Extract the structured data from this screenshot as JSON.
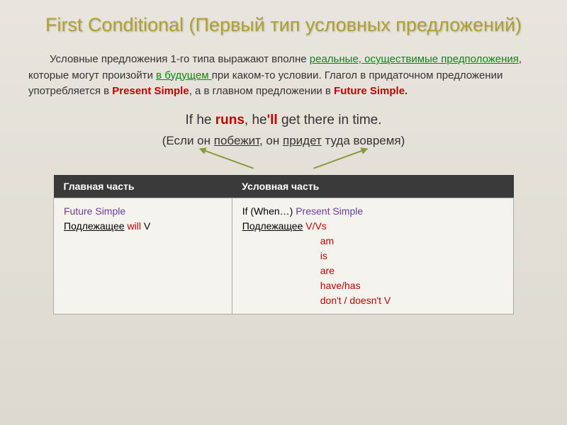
{
  "title": "First Conditional (Первый тип условных предложений)",
  "paragraph": {
    "p1": "Условные предложения 1-го типа выражают вполне ",
    "green1": "реальные, осуществимые предположения",
    "p2": ", которые могут произойти ",
    "green2": "в будущем ",
    "p3": "при каком-то условии. Глагол в придаточном предложении употребляется в ",
    "red1": "Present Simple",
    "p4": ", а в главном предложении в ",
    "red2": "Future Simple.",
    "p5": ""
  },
  "example_en": {
    "t1": "If he ",
    "verb1": "runs",
    "t2": ", he",
    "verb2": "'ll",
    "t3": " get there in time."
  },
  "example_ru": {
    "open": "(",
    "t1": "Если он ",
    "u1": "побежит",
    "t2": ", он ",
    "u2": "придет",
    "t3": " туда вовремя)",
    "close": ""
  },
  "table": {
    "header1": "Главная часть",
    "header2": "Условная часть",
    "cell1": {
      "line1a": "Future Simple",
      "line2a": "Подлежащее",
      "line2b": " will",
      "line2c": "  V"
    },
    "cell2": {
      "line1a": "If (When…) ",
      "line1b": "Present Simple",
      "line2a": "Подлежащее",
      "line2b": "  V/Vs",
      "line3": "am",
      "line4": "is",
      "line5": "are",
      "line6": "have/has",
      "line7": "don't / doesn't  V"
    }
  }
}
